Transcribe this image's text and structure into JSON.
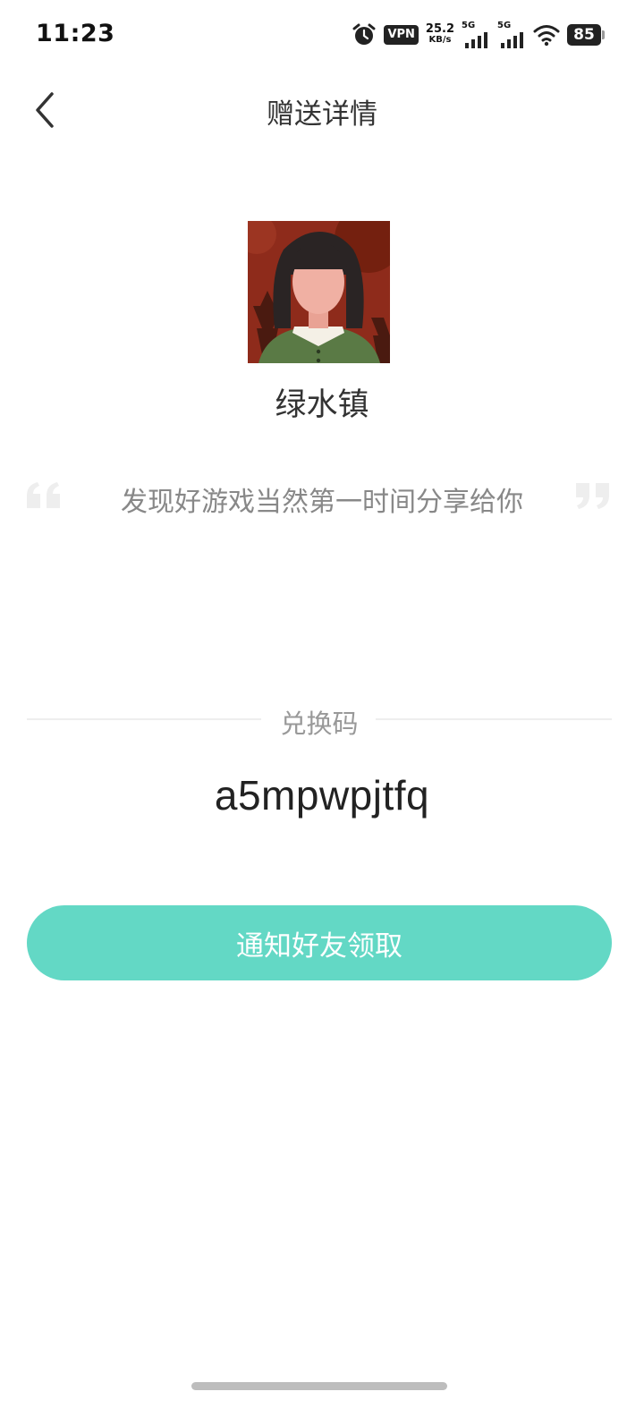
{
  "status_bar": {
    "time": "11:23",
    "vpn_label": "VPN",
    "net_speed_value": "25.2",
    "net_speed_unit": "KB/s",
    "sim1_tag": "5G",
    "sim2_tag": "5G",
    "battery": "85",
    "icons": [
      "alarm-icon",
      "vpn-icon",
      "signal-icon",
      "signal-icon",
      "wifi-icon",
      "battery-icon"
    ]
  },
  "nav": {
    "back_icon": "chevron-left-icon",
    "title": "赠送详情"
  },
  "sender": {
    "name": "绿水镇"
  },
  "message": {
    "text": "发现好游戏当然第一时间分享给你",
    "quote_icons": [
      "quote-open-icon",
      "quote-close-icon"
    ]
  },
  "code_section": {
    "label": "兑换码",
    "code": "a5mpwpjtfq"
  },
  "actions": {
    "notify_label": "通知好友领取"
  },
  "colors": {
    "accent": "#63d8c5",
    "title_text": "#333333",
    "secondary_text": "#888888",
    "divider": "#eeeeee"
  }
}
